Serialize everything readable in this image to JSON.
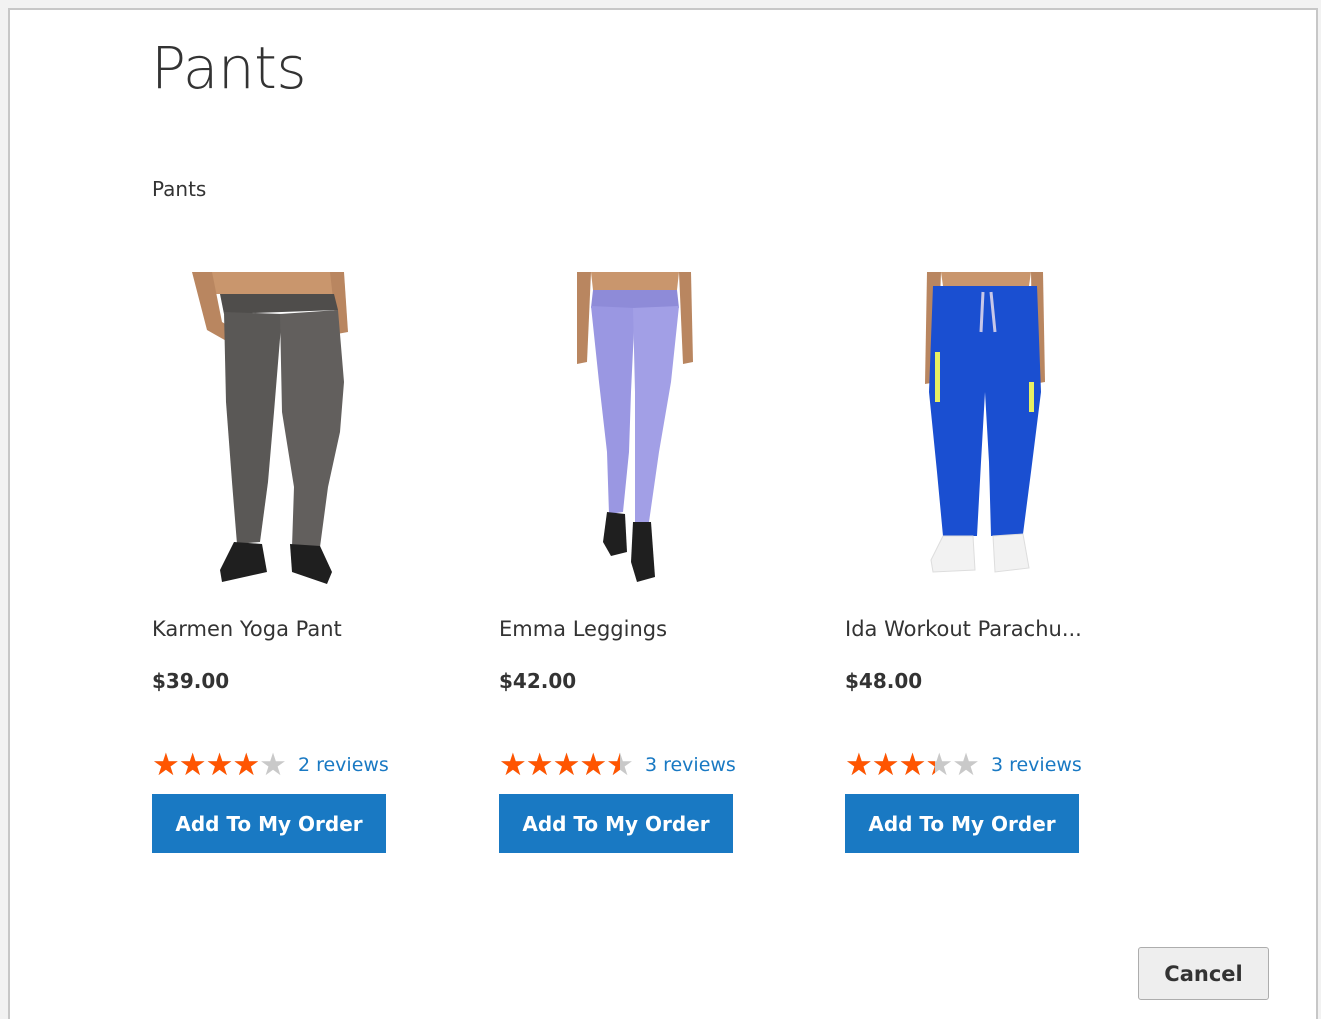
{
  "page": {
    "title": "Pants",
    "category_label": "Pants"
  },
  "products": [
    {
      "name": "Karmen Yoga Pant",
      "price": "$39.00",
      "rating_percent": 80,
      "reviews_label": "2 reviews",
      "button_label": "Add To My Order",
      "image_icon": "gray-yoga-pants-image",
      "pants_color": "#5a5856"
    },
    {
      "name": "Emma Leggings",
      "price": "$42.00",
      "rating_percent": 90,
      "reviews_label": "3 reviews",
      "button_label": "Add To My Order",
      "image_icon": "lavender-leggings-image",
      "pants_color": "#9a97e2"
    },
    {
      "name": "Ida Workout Parachu...",
      "price": "$48.00",
      "rating_percent": 67,
      "reviews_label": "3 reviews",
      "button_label": "Add To My Order",
      "image_icon": "blue-parachute-pants-image",
      "pants_color": "#1a4fd1"
    }
  ],
  "footer": {
    "cancel_label": "Cancel"
  },
  "colors": {
    "accent": "#1979c3",
    "star_filled": "#ff5501",
    "star_empty": "#c9c9c9",
    "text": "#333333"
  }
}
